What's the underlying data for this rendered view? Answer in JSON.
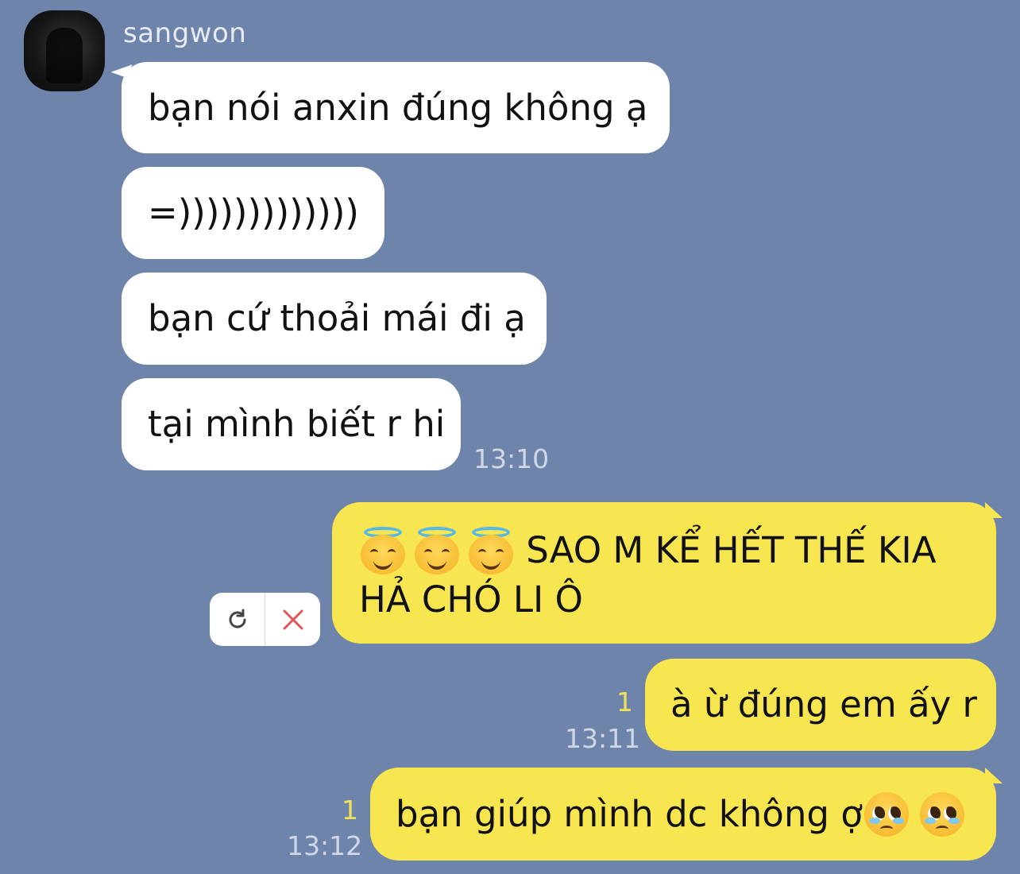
{
  "sender": {
    "name": "sangwon"
  },
  "incoming": [
    {
      "text": "bạn nói anxin đúng không ạ"
    },
    {
      "text": "=)))))))))))))"
    },
    {
      "text": "bạn cứ thoải mái đi ạ"
    },
    {
      "text": "tại mình biết r hi"
    }
  ],
  "incoming_time": "13:10",
  "outgoing": [
    {
      "emojis": [
        "smiling-face-with-halo",
        "smiling-face-with-halo",
        "smiling-face-with-halo"
      ],
      "line1": " SAO M KỂ HẾT THẾ KIA",
      "line2": "HẢ CHÓ LI Ô",
      "status": "failed"
    },
    {
      "text": "à ừ đúng em ấy r",
      "unread": "1",
      "time": "13:11"
    },
    {
      "text": "bạn giúp mình dc không ợ",
      "emojis": [
        "pleading-face",
        "pleading-face"
      ],
      "unread": "1",
      "time": "13:12"
    }
  ],
  "colors": {
    "background": "#6f84aa",
    "incoming_bubble": "#ffffff",
    "outgoing_bubble": "#f8e650",
    "unread": "#f3e05a",
    "delete_x": "#e05555"
  }
}
